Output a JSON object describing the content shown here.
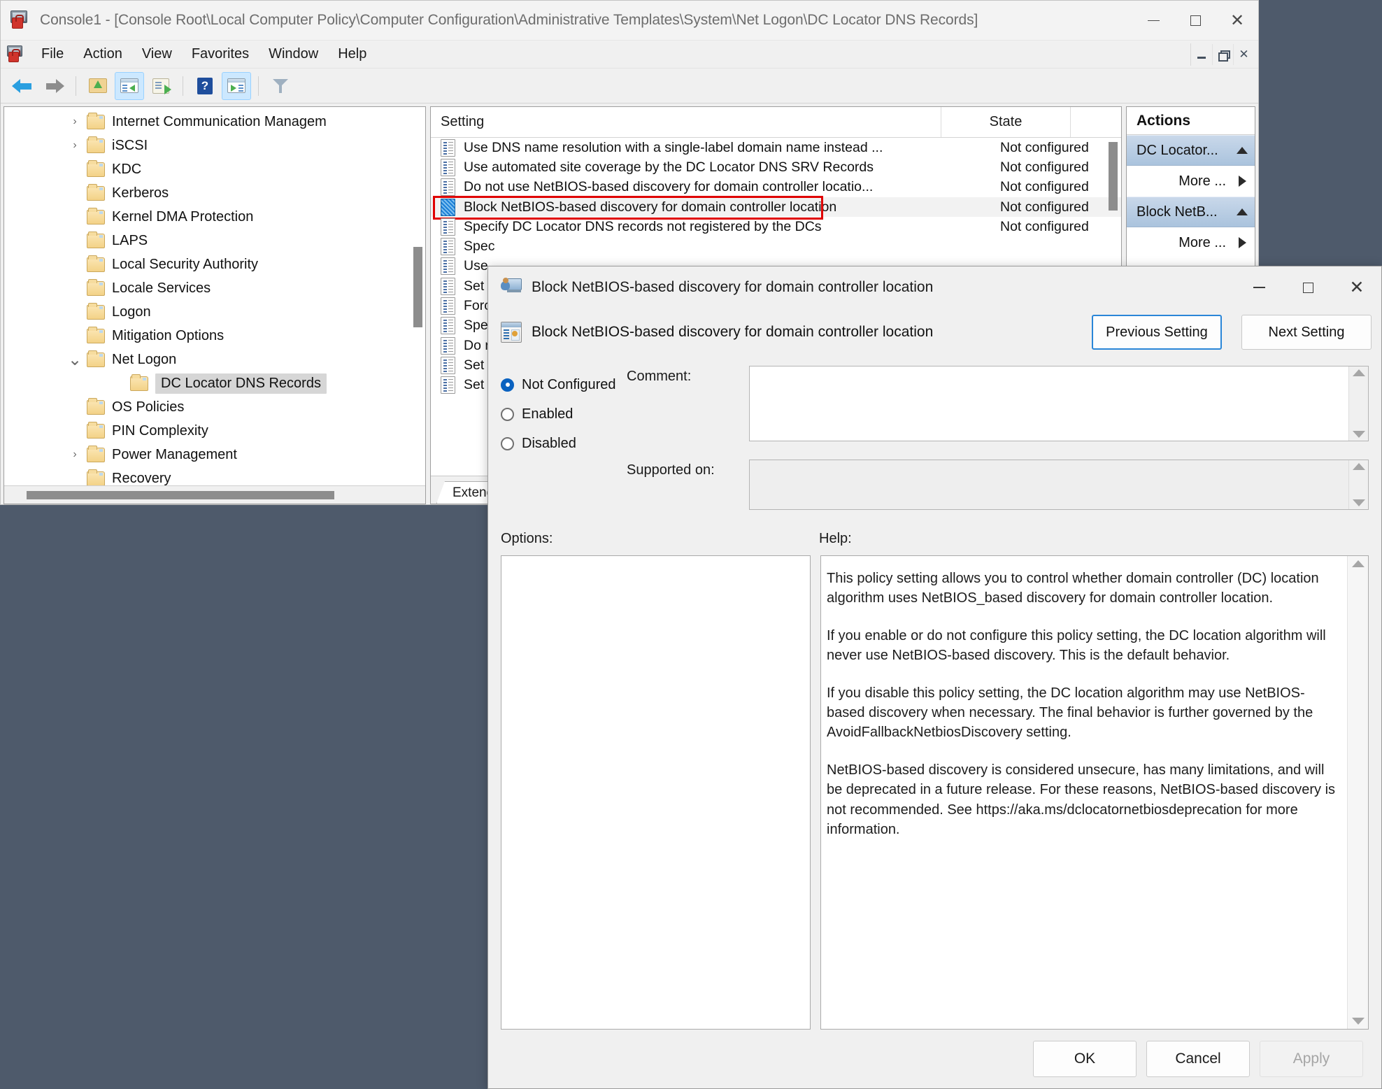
{
  "window": {
    "title": "Console1 - [Console Root\\Local Computer Policy\\Computer Configuration\\Administrative Templates\\System\\Net Logon\\DC Locator DNS Records]",
    "menu": [
      "File",
      "Action",
      "View",
      "Favorites",
      "Window",
      "Help"
    ]
  },
  "tree": {
    "items": [
      {
        "label": "Internet Communication Managem",
        "chevron": "right",
        "indent": 1,
        "selected": false
      },
      {
        "label": "iSCSI",
        "chevron": "right",
        "indent": 1,
        "selected": false
      },
      {
        "label": "KDC",
        "chevron": "none",
        "indent": 1,
        "selected": false
      },
      {
        "label": "Kerberos",
        "chevron": "none",
        "indent": 1,
        "selected": false
      },
      {
        "label": "Kernel DMA Protection",
        "chevron": "none",
        "indent": 1,
        "selected": false
      },
      {
        "label": "LAPS",
        "chevron": "none",
        "indent": 1,
        "selected": false
      },
      {
        "label": "Local Security Authority",
        "chevron": "none",
        "indent": 1,
        "selected": false
      },
      {
        "label": "Locale Services",
        "chevron": "none",
        "indent": 1,
        "selected": false
      },
      {
        "label": "Logon",
        "chevron": "none",
        "indent": 1,
        "selected": false
      },
      {
        "label": "Mitigation Options",
        "chevron": "none",
        "indent": 1,
        "selected": false
      },
      {
        "label": "Net Logon",
        "chevron": "down",
        "indent": 1,
        "selected": false
      },
      {
        "label": "DC Locator DNS Records",
        "chevron": "none",
        "indent": 2,
        "selected": true
      },
      {
        "label": "OS Policies",
        "chevron": "none",
        "indent": 1,
        "selected": false
      },
      {
        "label": "PIN Complexity",
        "chevron": "none",
        "indent": 1,
        "selected": false
      },
      {
        "label": "Power Management",
        "chevron": "right",
        "indent": 1,
        "selected": false
      },
      {
        "label": "Recovery",
        "chevron": "none",
        "indent": 1,
        "selected": false
      }
    ]
  },
  "list": {
    "columns": {
      "setting": "Setting",
      "state": "State"
    },
    "tab": "Extended",
    "rows": [
      {
        "setting": "Use DNS name resolution with a single-label domain name instead ...",
        "state": "Not configured",
        "selected": false,
        "highlighted": false
      },
      {
        "setting": "Use automated site coverage by the DC Locator DNS SRV Records",
        "state": "Not configured",
        "selected": false,
        "highlighted": false
      },
      {
        "setting": "Do not use NetBIOS-based discovery for domain controller locatio...",
        "state": "Not configured",
        "selected": false,
        "highlighted": false
      },
      {
        "setting": "Block NetBIOS-based discovery for domain controller location",
        "state": "Not configured",
        "selected": true,
        "highlighted": true
      },
      {
        "setting": "Specify DC Locator DNS records not registered by the DCs",
        "state": "Not configured",
        "selected": false,
        "highlighted": false
      },
      {
        "setting": "Spec",
        "state": "",
        "selected": false,
        "highlighted": false
      },
      {
        "setting": "Use",
        "state": "",
        "selected": false,
        "highlighted": false
      },
      {
        "setting": "Set T",
        "state": "",
        "selected": false,
        "highlighted": false
      },
      {
        "setting": "Forc",
        "state": "",
        "selected": false,
        "highlighted": false
      },
      {
        "setting": "Spec",
        "state": "",
        "selected": false,
        "highlighted": false
      },
      {
        "setting": "Do n",
        "state": "",
        "selected": false,
        "highlighted": false
      },
      {
        "setting": "Set F",
        "state": "",
        "selected": false,
        "highlighted": false
      },
      {
        "setting": "Set V",
        "state": "",
        "selected": false,
        "highlighted": false
      }
    ]
  },
  "actions": {
    "header": "Actions",
    "groups": [
      {
        "title": "DC Locator...",
        "item": "More ..."
      },
      {
        "title": "Block NetB...",
        "item": "More ..."
      }
    ]
  },
  "dialog": {
    "title": "Block NetBIOS-based discovery for domain controller location",
    "subtitle": "Block NetBIOS-based discovery for domain controller location",
    "previous_button": "Previous Setting",
    "next_button": "Next Setting",
    "radios": [
      {
        "label": "Not Configured",
        "checked": true
      },
      {
        "label": "Enabled",
        "checked": false
      },
      {
        "label": "Disabled",
        "checked": false
      }
    ],
    "comment_label": "Comment:",
    "comment_value": "",
    "supported_label": "Supported on:",
    "supported_value": "",
    "options_label": "Options:",
    "help_label": "Help:",
    "help_paragraphs": [
      "This policy setting allows you to control whether domain controller (DC) location algorithm uses NetBIOS_based discovery for domain controller location.",
      "If you enable or do not configure this policy setting, the DC location algorithm will never use NetBIOS-based discovery. This is the default behavior.",
      "If you disable this policy setting, the DC location algorithm may use NetBIOS-based discovery when necessary. The final behavior is further governed by the AvoidFallbackNetbiosDiscovery setting.",
      "NetBIOS-based discovery is considered unsecure, has many limitations, and will be deprecated in a future release. For these reasons, NetBIOS-based discovery is not recommended. See https://aka.ms/dclocatornetbiosdeprecation for more information."
    ],
    "buttons": {
      "ok": "OK",
      "cancel": "Cancel",
      "apply": "Apply"
    }
  },
  "colors": {
    "desktop": "#4e5a6b",
    "highlight_box": "#e00000",
    "accent_blue": "#0a62c0",
    "actions_group": "#aac3dd"
  }
}
